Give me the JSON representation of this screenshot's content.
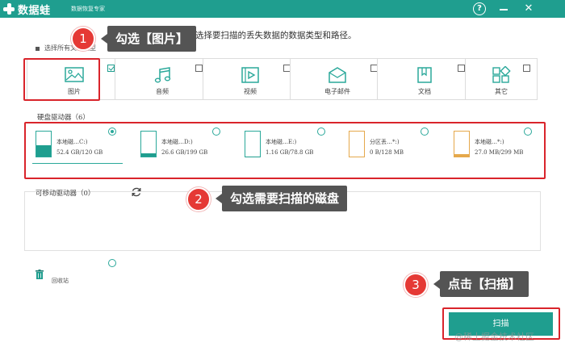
{
  "app": {
    "title": "数据蛙",
    "subtitle": "数据恢复专家",
    "help_label": "?",
    "close_label": "✕"
  },
  "hint": "选择要扫描的丢失数据的数据类型和路径。",
  "select_all": "选择所有文件类型",
  "file_types": [
    {
      "label": "图片",
      "icon": "image-icon",
      "checked": true
    },
    {
      "label": "音频",
      "icon": "music-icon",
      "checked": false
    },
    {
      "label": "视频",
      "icon": "video-icon",
      "checked": false
    },
    {
      "label": "电子邮件",
      "icon": "email-icon",
      "checked": false
    },
    {
      "label": "文档",
      "icon": "document-icon",
      "checked": false
    },
    {
      "label": "其它",
      "icon": "other-icon",
      "checked": false
    }
  ],
  "hard_drives": {
    "label": "硬盘驱动器（6）",
    "items": [
      {
        "name": "本地磁…C:)",
        "size": "52.4 GB/120 GB",
        "used_fraction": 0.44,
        "color": "#1f9e8f",
        "selected": true
      },
      {
        "name": "本地磁…D:)",
        "size": "26.6 GB/199 GB",
        "used_fraction": 0.13,
        "color": "#1f9e8f",
        "selected": false
      },
      {
        "name": "本地磁…E:)",
        "size": "1.16 GB/78.8 GB",
        "used_fraction": 0.01,
        "color": "#1f9e8f",
        "selected": false
      },
      {
        "name": "分区丢…*:)",
        "size": "0  B/128 MB",
        "used_fraction": 0.0,
        "color": "#e5a84b",
        "selected": false
      },
      {
        "name": "本地磁…*:)",
        "size": "27.0 MB/299 MB",
        "used_fraction": 0.09,
        "color": "#e5a84b",
        "selected": false
      }
    ]
  },
  "removable": {
    "label": "可移动驱动器（0）"
  },
  "trash": {
    "label": "回收站"
  },
  "scan_button": "扫描",
  "callouts": [
    {
      "number": "1",
      "text": "勾选【图片】"
    },
    {
      "number": "2",
      "text": "勾选需要扫描的磁盘"
    },
    {
      "number": "3",
      "text": "点击【扫描】"
    }
  ],
  "watermark": "@稀土掘金技术社区",
  "colors": {
    "accent": "#1f9e8f",
    "highlight": "#d9242b",
    "callout": "#545454"
  }
}
